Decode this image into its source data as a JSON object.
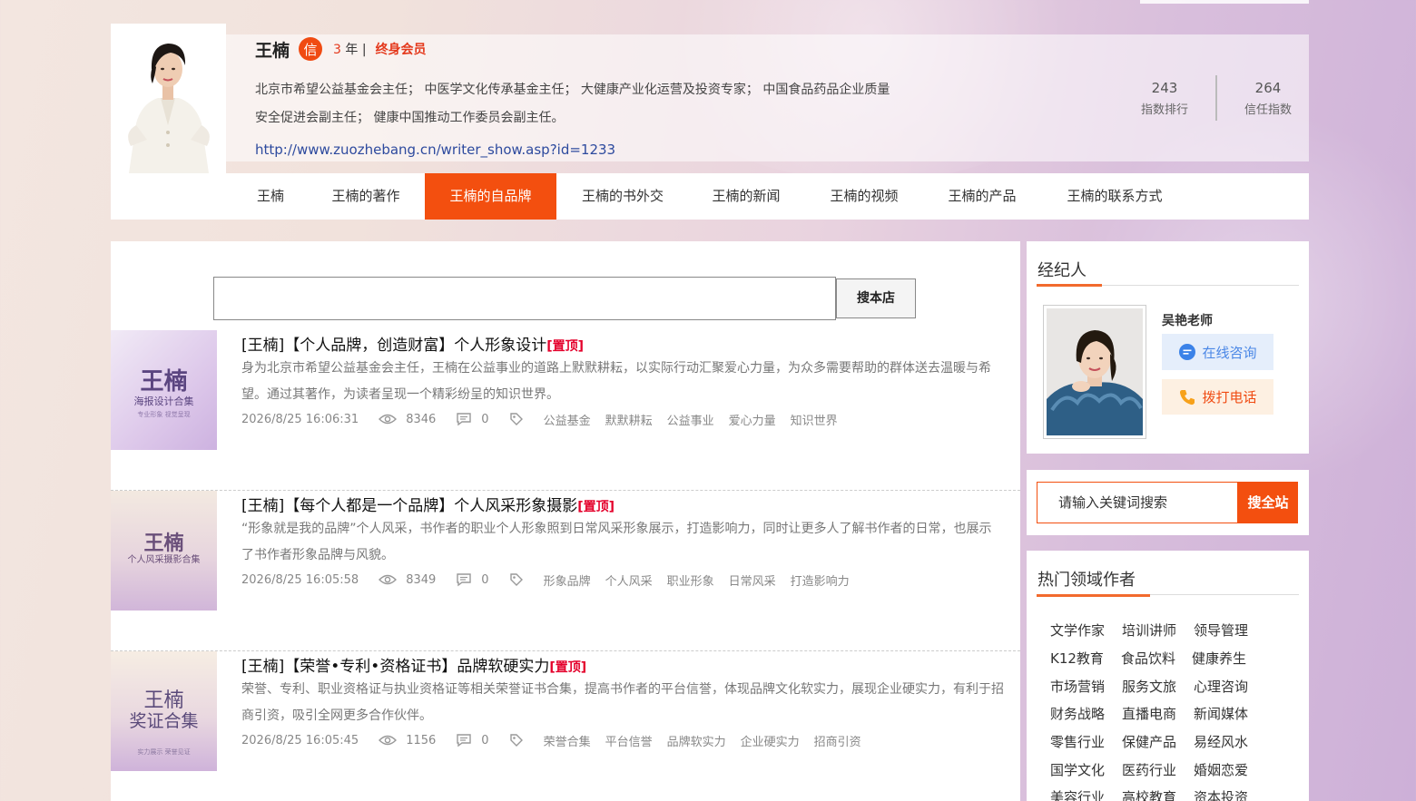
{
  "author": {
    "name": "王楠",
    "badge": "信",
    "years_num": "3",
    "years_suffix": " 年 |",
    "membership": "终身会员",
    "bio": "北京市希望公益基金会主任； 中医学文化传承基金主任； 大健康产业化运营及投资专家； 中国食品药品企业质量安全促进会副主任； 健康中国推动工作委员会副主任。",
    "homepage": "http://www.zuozhebang.cn/writer_show.asp?id=1233",
    "stats": [
      {
        "value": "243",
        "label": "指数排行"
      },
      {
        "value": "264",
        "label": "信任指数"
      }
    ]
  },
  "nav": {
    "items": [
      {
        "label": "王楠"
      },
      {
        "label": "王楠的著作"
      },
      {
        "label": "王楠的自品牌"
      },
      {
        "label": "王楠的书外交"
      },
      {
        "label": "王楠的新闻"
      },
      {
        "label": "王楠的视频"
      },
      {
        "label": "王楠的产品"
      },
      {
        "label": "王楠的联系方式"
      }
    ],
    "active": "王楠的自品牌"
  },
  "store_search": {
    "value": "",
    "button": "搜本店"
  },
  "articles": [
    {
      "thumb_title": "王楠",
      "thumb_sub": "海报设计合集",
      "thumb_small": "专业形象 视觉呈现",
      "title": "[王楠]【个人品牌，创造财富】个人形象设计",
      "pin": "[置顶]",
      "desc": "身为北京市希望公益基金会主任，王楠在公益事业的道路上默默耕耘，以实际行动汇聚爱心力量，为众多需要帮助的群体送去温暖与希望。通过其著作，为读者呈现一个精彩纷呈的知识世界。",
      "date": "2026/8/25 16:06:31",
      "views": "8346",
      "comments": "0",
      "tags": [
        "公益基金",
        "默默耕耘",
        "公益事业",
        "爱心力量",
        "知识世界"
      ]
    },
    {
      "thumb_title": "王楠",
      "thumb_sub": "个人风采摄影合集",
      "thumb_small": "",
      "title": "[王楠]【每个人都是一个品牌】个人风采形象摄影",
      "pin": "[置顶]",
      "desc": "“形象就是我的品牌”个人风采，书作者的职业个人形象照到日常风采形象展示，打造影响力，同时让更多人了解书作者的日常，也展示了书作者形象品牌与风貌。",
      "date": "2026/8/25 16:05:58",
      "views": "8349",
      "comments": "0",
      "tags": [
        "形象品牌",
        "个人风采",
        "职业形象",
        "日常风采",
        "打造影响力"
      ]
    },
    {
      "thumb_title": "王楠",
      "thumb_sub": "奖证合集",
      "thumb_small": "实力展示 荣誉见证",
      "title": "[王楠]【荣誉•专利•资格证书】品牌软硬实力",
      "pin": "[置顶]",
      "desc": "荣誉、专利、职业资格证与执业资格证等相关荣誉证书合集，提高书作者的平台信誉，体现品牌文化软实力，展现企业硬实力，有利于招商引资，吸引全网更多合作伙伴。",
      "date": "2026/8/25 16:05:45",
      "views": "1156",
      "comments": "0",
      "tags": [
        "荣誉合集",
        "平台信誉",
        "品牌软实力",
        "企业硬实力",
        "招商引资"
      ]
    }
  ],
  "agent": {
    "section_title": "经纪人",
    "name": "吴艳老师",
    "consult": "在线咨询",
    "call": "拨打电话"
  },
  "site_search": {
    "placeholder": "请输入关键词搜索",
    "button": "搜全站"
  },
  "hot_fields": {
    "title": "热门领域作者",
    "items": [
      "文学作家",
      "培训讲师",
      "领导管理",
      "K12教育",
      "食品饮料",
      "健康养生",
      "市场营销",
      "服务文旅",
      "心理咨询",
      "财务战略",
      "直播电商",
      "新闻媒体",
      "零售行业",
      "保健产品",
      "易经风水",
      "国学文化",
      "医药行业",
      "婚姻恋爱",
      "美容行业",
      "高校教育",
      "资本投资"
    ]
  },
  "colors": {
    "accent": "#f34f0f",
    "pin": "#e4002b",
    "link": "#2d4a9e"
  }
}
